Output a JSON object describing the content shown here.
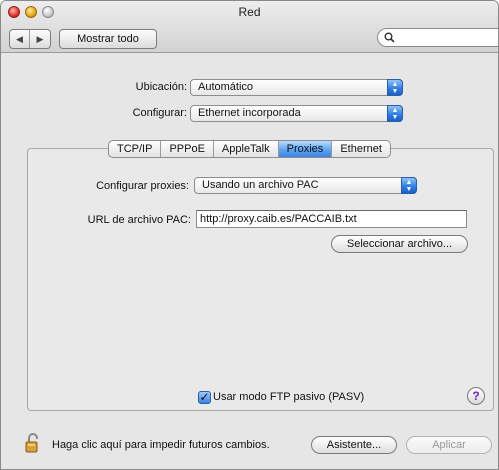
{
  "window": {
    "title": "Red"
  },
  "toolbar": {
    "back_glyph": "◀",
    "forward_glyph": "▶",
    "show_all_label": "Mostrar todo",
    "search_value": "",
    "search_icon": "search-icon"
  },
  "location": {
    "label": "Ubicación:",
    "value": "Automático"
  },
  "configure": {
    "label": "Configurar:",
    "value": "Ethernet incorporada"
  },
  "tabs": [
    {
      "label": "TCP/IP",
      "active": false
    },
    {
      "label": "PPPoE",
      "active": false
    },
    {
      "label": "AppleTalk",
      "active": false
    },
    {
      "label": "Proxies",
      "active": true
    },
    {
      "label": "Ethernet",
      "active": false
    }
  ],
  "proxies": {
    "configure_label": "Configurar proxies:",
    "configure_value": "Usando un archivo PAC",
    "pac_url_label": "URL de archivo PAC:",
    "pac_url_value": "http://proxy.caib.es/PACCAIB.txt",
    "choose_file_label": "Seleccionar archivo...",
    "passive_ftp_label": "Usar modo FTP pasivo (PASV)",
    "passive_ftp_checked": true
  },
  "footer": {
    "lock_text": "Haga clic aquí para impedir futuros cambios.",
    "assistant_label": "Asistente...",
    "apply_label": "Aplicar"
  },
  "colors": {
    "accent": "#3f86e0",
    "window_bg": "#e6e6e6"
  }
}
